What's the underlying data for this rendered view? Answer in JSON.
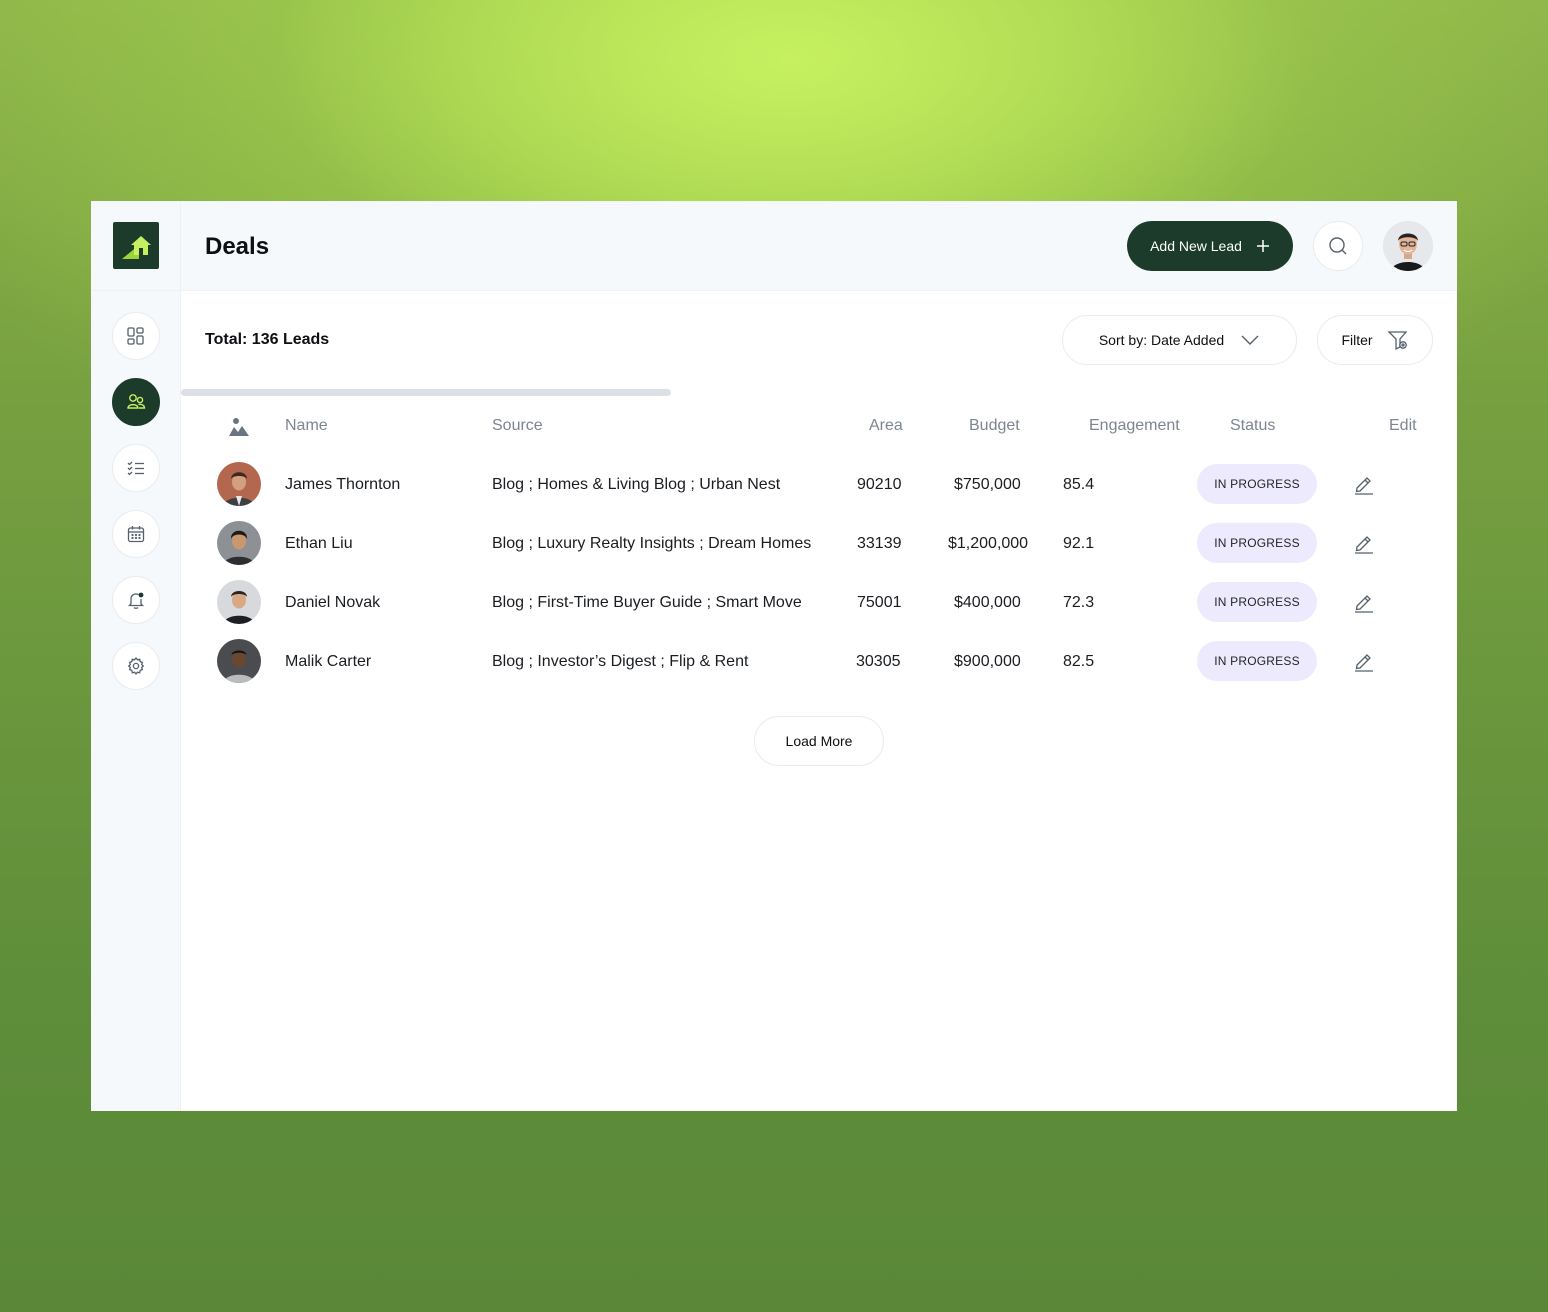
{
  "header": {
    "title": "Deals",
    "add_button_label": "Add New Lead"
  },
  "toolbar": {
    "total_label": "Total: 136 Leads",
    "sort_label": "Sort by: Date Added",
    "filter_label": "Filter"
  },
  "sidebar": {
    "items": [
      {
        "name": "dashboard",
        "icon": "grid-icon",
        "active": false
      },
      {
        "name": "leads",
        "icon": "users-icon",
        "active": true
      },
      {
        "name": "tasks",
        "icon": "checklist-icon",
        "active": false
      },
      {
        "name": "calendar",
        "icon": "calendar-icon",
        "active": false
      },
      {
        "name": "notifications",
        "icon": "bell-icon",
        "active": false
      },
      {
        "name": "settings",
        "icon": "gear-icon",
        "active": false
      }
    ]
  },
  "table": {
    "columns": {
      "avatar_icon": "image-icon",
      "name": "Name",
      "source": "Source",
      "area": "Area",
      "budget": "Budget",
      "engagement": "Engagement",
      "status": "Status",
      "edit": "Edit"
    },
    "rows": [
      {
        "name": "James Thornton",
        "source": "Blog ; Homes & Living Blog ; Urban Nest",
        "area": "90210",
        "budget": "$750,000",
        "engagement": "85.4",
        "status": "IN PROGRESS"
      },
      {
        "name": "Ethan Liu",
        "source": "Blog ; Luxury Realty Insights ; Dream Homes",
        "area": "33139",
        "budget": "$1,200,000",
        "engagement": "92.1",
        "status": "IN PROGRESS"
      },
      {
        "name": "Daniel Novak",
        "source": "Blog ; First-Time Buyer Guide ; Smart Move",
        "area": "75001",
        "budget": "$400,000",
        "engagement": "72.3",
        "status": "IN PROGRESS"
      },
      {
        "name": "Malik Carter",
        "source": "Blog ; Investor’s Digest ; Flip & Rent",
        "area": "30305",
        "budget": "$900,000",
        "engagement": "82.5",
        "status": "IN PROGRESS"
      }
    ]
  },
  "load_more_label": "Load More",
  "colors": {
    "brand": "#1c3b2a",
    "accent": "#c6f060",
    "status_bg": "#eceafc"
  }
}
